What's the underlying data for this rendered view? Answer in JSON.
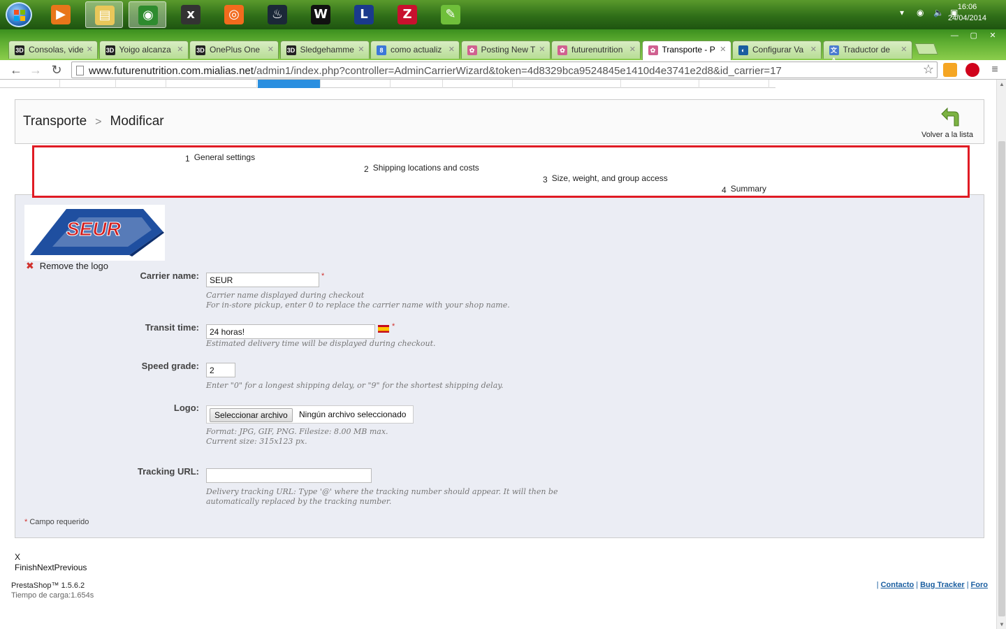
{
  "taskbar": {
    "clock_time": "16:06",
    "clock_date": "24/04/2014",
    "apps": [
      {
        "name": "media-player-icon",
        "color": "#e8761a",
        "glyph": "▶"
      },
      {
        "name": "file-explorer-icon",
        "color": "#e9c75a",
        "glyph": "▤"
      },
      {
        "name": "chrome-icon",
        "color": "#2e8b2e",
        "glyph": "◉"
      },
      {
        "name": "xbmc-icon",
        "color": "#333333",
        "glyph": "x"
      },
      {
        "name": "origin-icon",
        "color": "#f26b1d",
        "glyph": "◎"
      },
      {
        "name": "steam-icon",
        "color": "#1b2838",
        "glyph": "♨"
      },
      {
        "name": "w-app-icon",
        "color": "#111111",
        "glyph": "W"
      },
      {
        "name": "league-of-legends-icon",
        "color": "#1a3a8c",
        "glyph": "L"
      },
      {
        "name": "filezilla-icon",
        "color": "#c8102e",
        "glyph": "Z"
      },
      {
        "name": "notepad-plus-icon",
        "color": "#6fbf3a",
        "glyph": "✎"
      }
    ]
  },
  "browser": {
    "tabs": [
      {
        "label": "Consolas, vide",
        "icon": "3D",
        "color": "#222222"
      },
      {
        "label": "Yoigo alcanza",
        "icon": "3D",
        "color": "#222222"
      },
      {
        "label": "OnePlus One",
        "icon": "3D",
        "color": "#222222"
      },
      {
        "label": "Sledgehamme",
        "icon": "3D",
        "color": "#222222"
      },
      {
        "label": "como actualiz",
        "icon": "8",
        "color": "#3c78d8"
      },
      {
        "label": "Posting New T",
        "icon": "✿",
        "color": "#d06090"
      },
      {
        "label": "futurenutrition",
        "icon": "✿",
        "color": "#d06090"
      },
      {
        "label": "Transporte - P",
        "icon": "✿",
        "color": "#d06090"
      },
      {
        "label": "Configurar Va",
        "icon": "◐",
        "color": "#1a5ea0"
      },
      {
        "label": "Traductor de",
        "icon": "文A",
        "color": "#4a7bd0"
      }
    ],
    "url_host": "www.futurenutrition.com.mialias.net",
    "url_path": "/admin1/index.php?controller=AdminCarrierWizard&token=4d8329bca9524845e1410d4e3741e2d8&id_carrier=17"
  },
  "toolbar": {
    "breadcrumb_1": "Transporte",
    "breadcrumb_sep": ">",
    "breadcrumb_2": "Modificar",
    "back_label": "Volver a la lista"
  },
  "steps": [
    {
      "num": "1",
      "label": "General settings"
    },
    {
      "num": "2",
      "label": "Shipping locations and costs"
    },
    {
      "num": "3",
      "label": "Size, weight, and group access"
    },
    {
      "num": "4",
      "label": "Summary"
    }
  ],
  "form": {
    "logo_text": "SEUR",
    "remove_logo": "Remove the logo",
    "carrier_name_label": "Carrier name:",
    "carrier_name_value": "SEUR",
    "carrier_name_hint_1": "Carrier name displayed during checkout",
    "carrier_name_hint_2": "For in-store pickup, enter 0 to replace the carrier name with your shop name.",
    "transit_label": "Transit time:",
    "transit_value": "24 horas!",
    "transit_hint": "Estimated delivery time will be displayed during checkout.",
    "speed_label": "Speed grade:",
    "speed_value": "2",
    "speed_hint": "Enter \"0\" for a longest shipping delay, or \"9\" for the shortest shipping delay.",
    "logo_label": "Logo:",
    "file_button": "Seleccionar archivo",
    "file_status": "Ningún archivo seleccionado",
    "logo_hint_1": "Format: JPG, GIF, PNG. Filesize: 8.00 MB max.",
    "logo_hint_2": "Current size: 315x123 px.",
    "tracking_label": "Tracking URL:",
    "tracking_value": "",
    "tracking_hint_1": "Delivery tracking URL: Type '@' where the tracking number should appear. It will then be",
    "tracking_hint_2": "automatically replaced by the tracking number.",
    "required_star": "*",
    "required_note": "Campo requerido"
  },
  "wizard_footer": {
    "close": "X",
    "buttons": "FinishNextPrevious"
  },
  "footer": {
    "version": "PrestaShop™ 1.5.6.2",
    "load_time": "Tiempo de carga:1.654s",
    "links": [
      "Contacto",
      "Bug Tracker",
      "Foro"
    ]
  }
}
